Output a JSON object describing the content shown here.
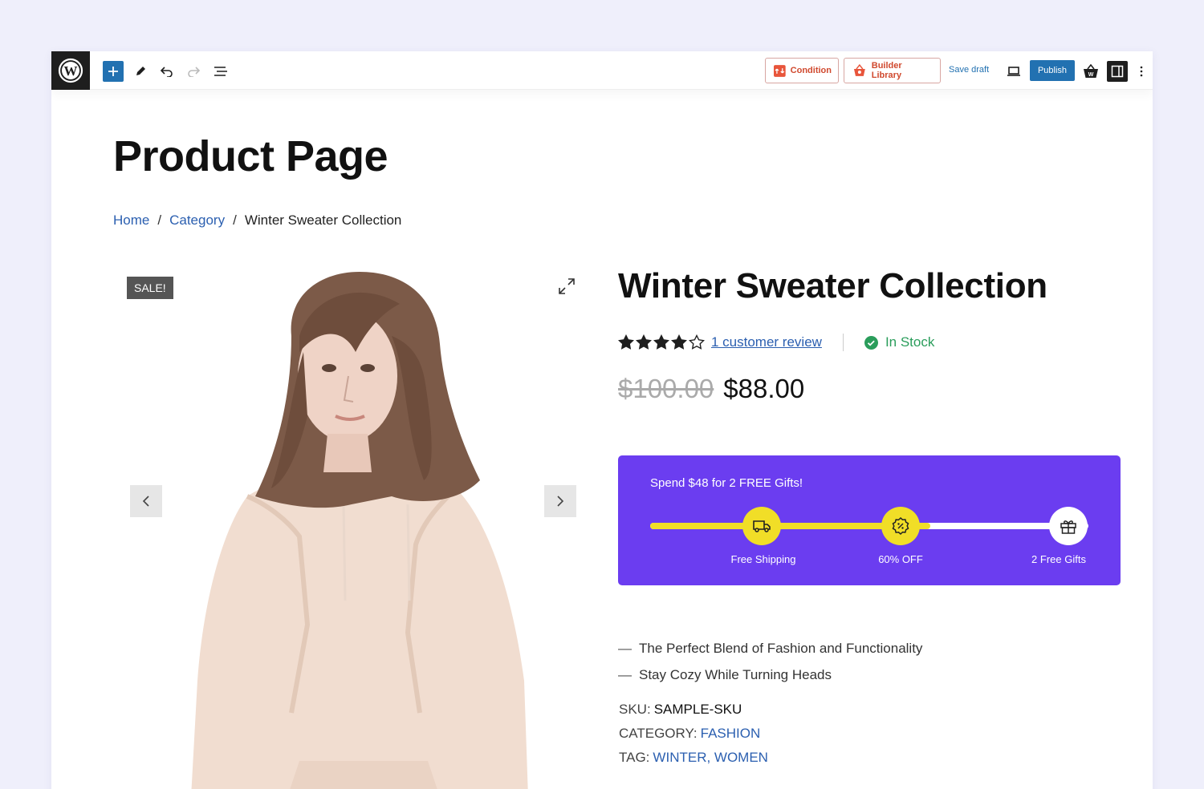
{
  "toolbar": {
    "condition_label": "Condition",
    "builder_library_label": "Builder Library",
    "save_draft_label": "Save draft",
    "publish_label": "Publish"
  },
  "page": {
    "title": "Product Page"
  },
  "breadcrumb": {
    "home": "Home",
    "sep1": "/",
    "category": "Category",
    "sep2": "/",
    "current": "Winter Sweater Collection"
  },
  "gallery": {
    "sale_badge": "SALE!"
  },
  "product": {
    "title": "Winter Sweater Collection",
    "rating": 4,
    "rating_max": 5,
    "review_link": "1 customer review",
    "stock": "In Stock",
    "old_price": "$100.00",
    "new_price": "$88.00"
  },
  "gift_progress": {
    "heading": "Spend $48 for 2 FREE Gifts!",
    "progress": 0.64,
    "milestones": [
      {
        "label": "Free Shipping",
        "icon": "truck-icon",
        "reached": true
      },
      {
        "label": "60% OFF",
        "icon": "discount-badge-icon",
        "reached": true
      },
      {
        "label": "2 Free Gifts",
        "icon": "gift-icon",
        "reached": false
      }
    ]
  },
  "features": [
    {
      "dash": "—",
      "text": "The Perfect Blend of Fashion and Functionality"
    },
    {
      "dash": "—",
      "text": "Stay Cozy While Turning Heads"
    }
  ],
  "meta": {
    "sku_label": "SKU:",
    "sku_value": "SAMPLE-SKU",
    "category_label": "CATEGORY:",
    "category_value": "FASHION",
    "tag_label": "TAG:",
    "tag_value": "WINTER, WOMEN"
  },
  "colors": {
    "accent_blue": "#2271b1",
    "promo_purple": "#6b3df0",
    "progress_yellow": "#f1de27",
    "stock_green": "#2a9d5b",
    "link_blue": "#2b5fb0"
  }
}
